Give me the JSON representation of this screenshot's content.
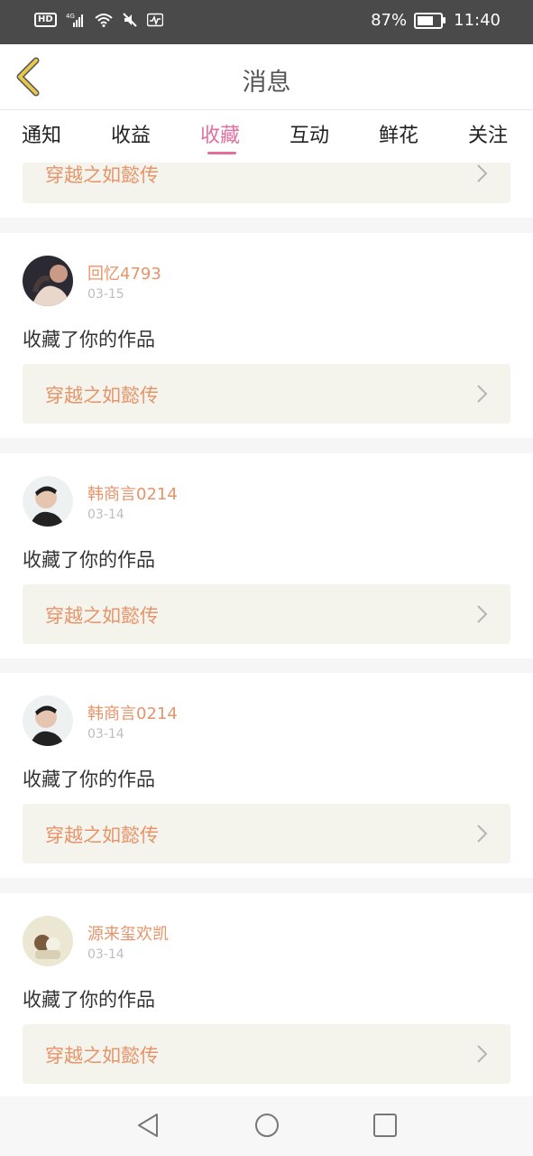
{
  "status_bar": {
    "network": "4G",
    "battery_percent_label": "87%",
    "battery_level": 0.87,
    "time": "11:40"
  },
  "header": {
    "title": "消息"
  },
  "tabs": [
    {
      "label": "通知",
      "active": false
    },
    {
      "label": "收益",
      "active": false
    },
    {
      "label": "收藏",
      "active": true
    },
    {
      "label": "互动",
      "active": false
    },
    {
      "label": "鲜花",
      "active": false
    },
    {
      "label": "关注",
      "active": false
    }
  ],
  "partial_item": {
    "work_title": "穿越之如懿传"
  },
  "items": [
    {
      "username": "回忆4793",
      "date": "03-15",
      "action": "收藏了你的作品",
      "work_title": "穿越之如懿传"
    },
    {
      "username": "韩商言0214",
      "date": "03-14",
      "action": "收藏了你的作品",
      "work_title": "穿越之如懿传"
    },
    {
      "username": "韩商言0214",
      "date": "03-14",
      "action": "收藏了你的作品",
      "work_title": "穿越之如懿传"
    },
    {
      "username": "源来玺欢凯",
      "date": "03-14",
      "action": "收藏了你的作品",
      "work_title": "穿越之如懿传"
    }
  ],
  "colors": {
    "accent": "#e26fa0",
    "username": "#e6946a",
    "work_bg": "#f4f4ec",
    "back_arrow": "#e8c84a"
  },
  "icons": {
    "back": "back-arrow-icon",
    "chevron": "chevron-right-icon",
    "nav": [
      "back-triangle-icon",
      "home-circle-icon",
      "recents-square-icon"
    ]
  }
}
